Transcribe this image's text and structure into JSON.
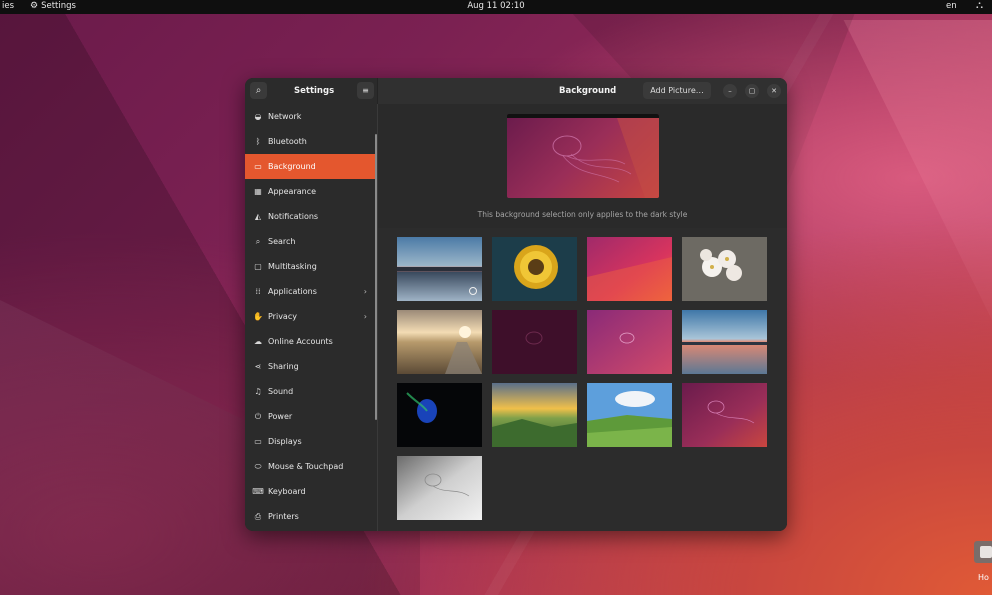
{
  "topbar": {
    "activities": "ies",
    "app_name": "Settings",
    "clock": "Aug 11  02:10",
    "lang": "en"
  },
  "window": {
    "sidebar_title": "Settings",
    "page_title": "Background",
    "add_picture": "Add Picture…"
  },
  "sidebar": {
    "items": [
      {
        "label": "Network",
        "icon": "◒"
      },
      {
        "label": "Bluetooth",
        "icon": "ᛒ"
      },
      {
        "label": "Background",
        "icon": "▭"
      },
      {
        "label": "Appearance",
        "icon": "▦"
      },
      {
        "label": "Notifications",
        "icon": "◭"
      },
      {
        "label": "Search",
        "icon": "⌕"
      },
      {
        "label": "Multitasking",
        "icon": "▢"
      },
      {
        "label": "Applications",
        "icon": "⁞⁞"
      },
      {
        "label": "Privacy",
        "icon": "✋"
      },
      {
        "label": "Online Accounts",
        "icon": "☁"
      },
      {
        "label": "Sharing",
        "icon": "⋖"
      },
      {
        "label": "Sound",
        "icon": "♫"
      },
      {
        "label": "Power",
        "icon": "⏻"
      },
      {
        "label": "Displays",
        "icon": "▭"
      },
      {
        "label": "Mouse & Touchpad",
        "icon": "⬭"
      },
      {
        "label": "Keyboard",
        "icon": "⌨"
      },
      {
        "label": "Printers",
        "icon": "⎙"
      }
    ]
  },
  "background": {
    "note": "This background selection only applies to the dark style"
  },
  "desktop": {
    "home_label": "Ho"
  }
}
